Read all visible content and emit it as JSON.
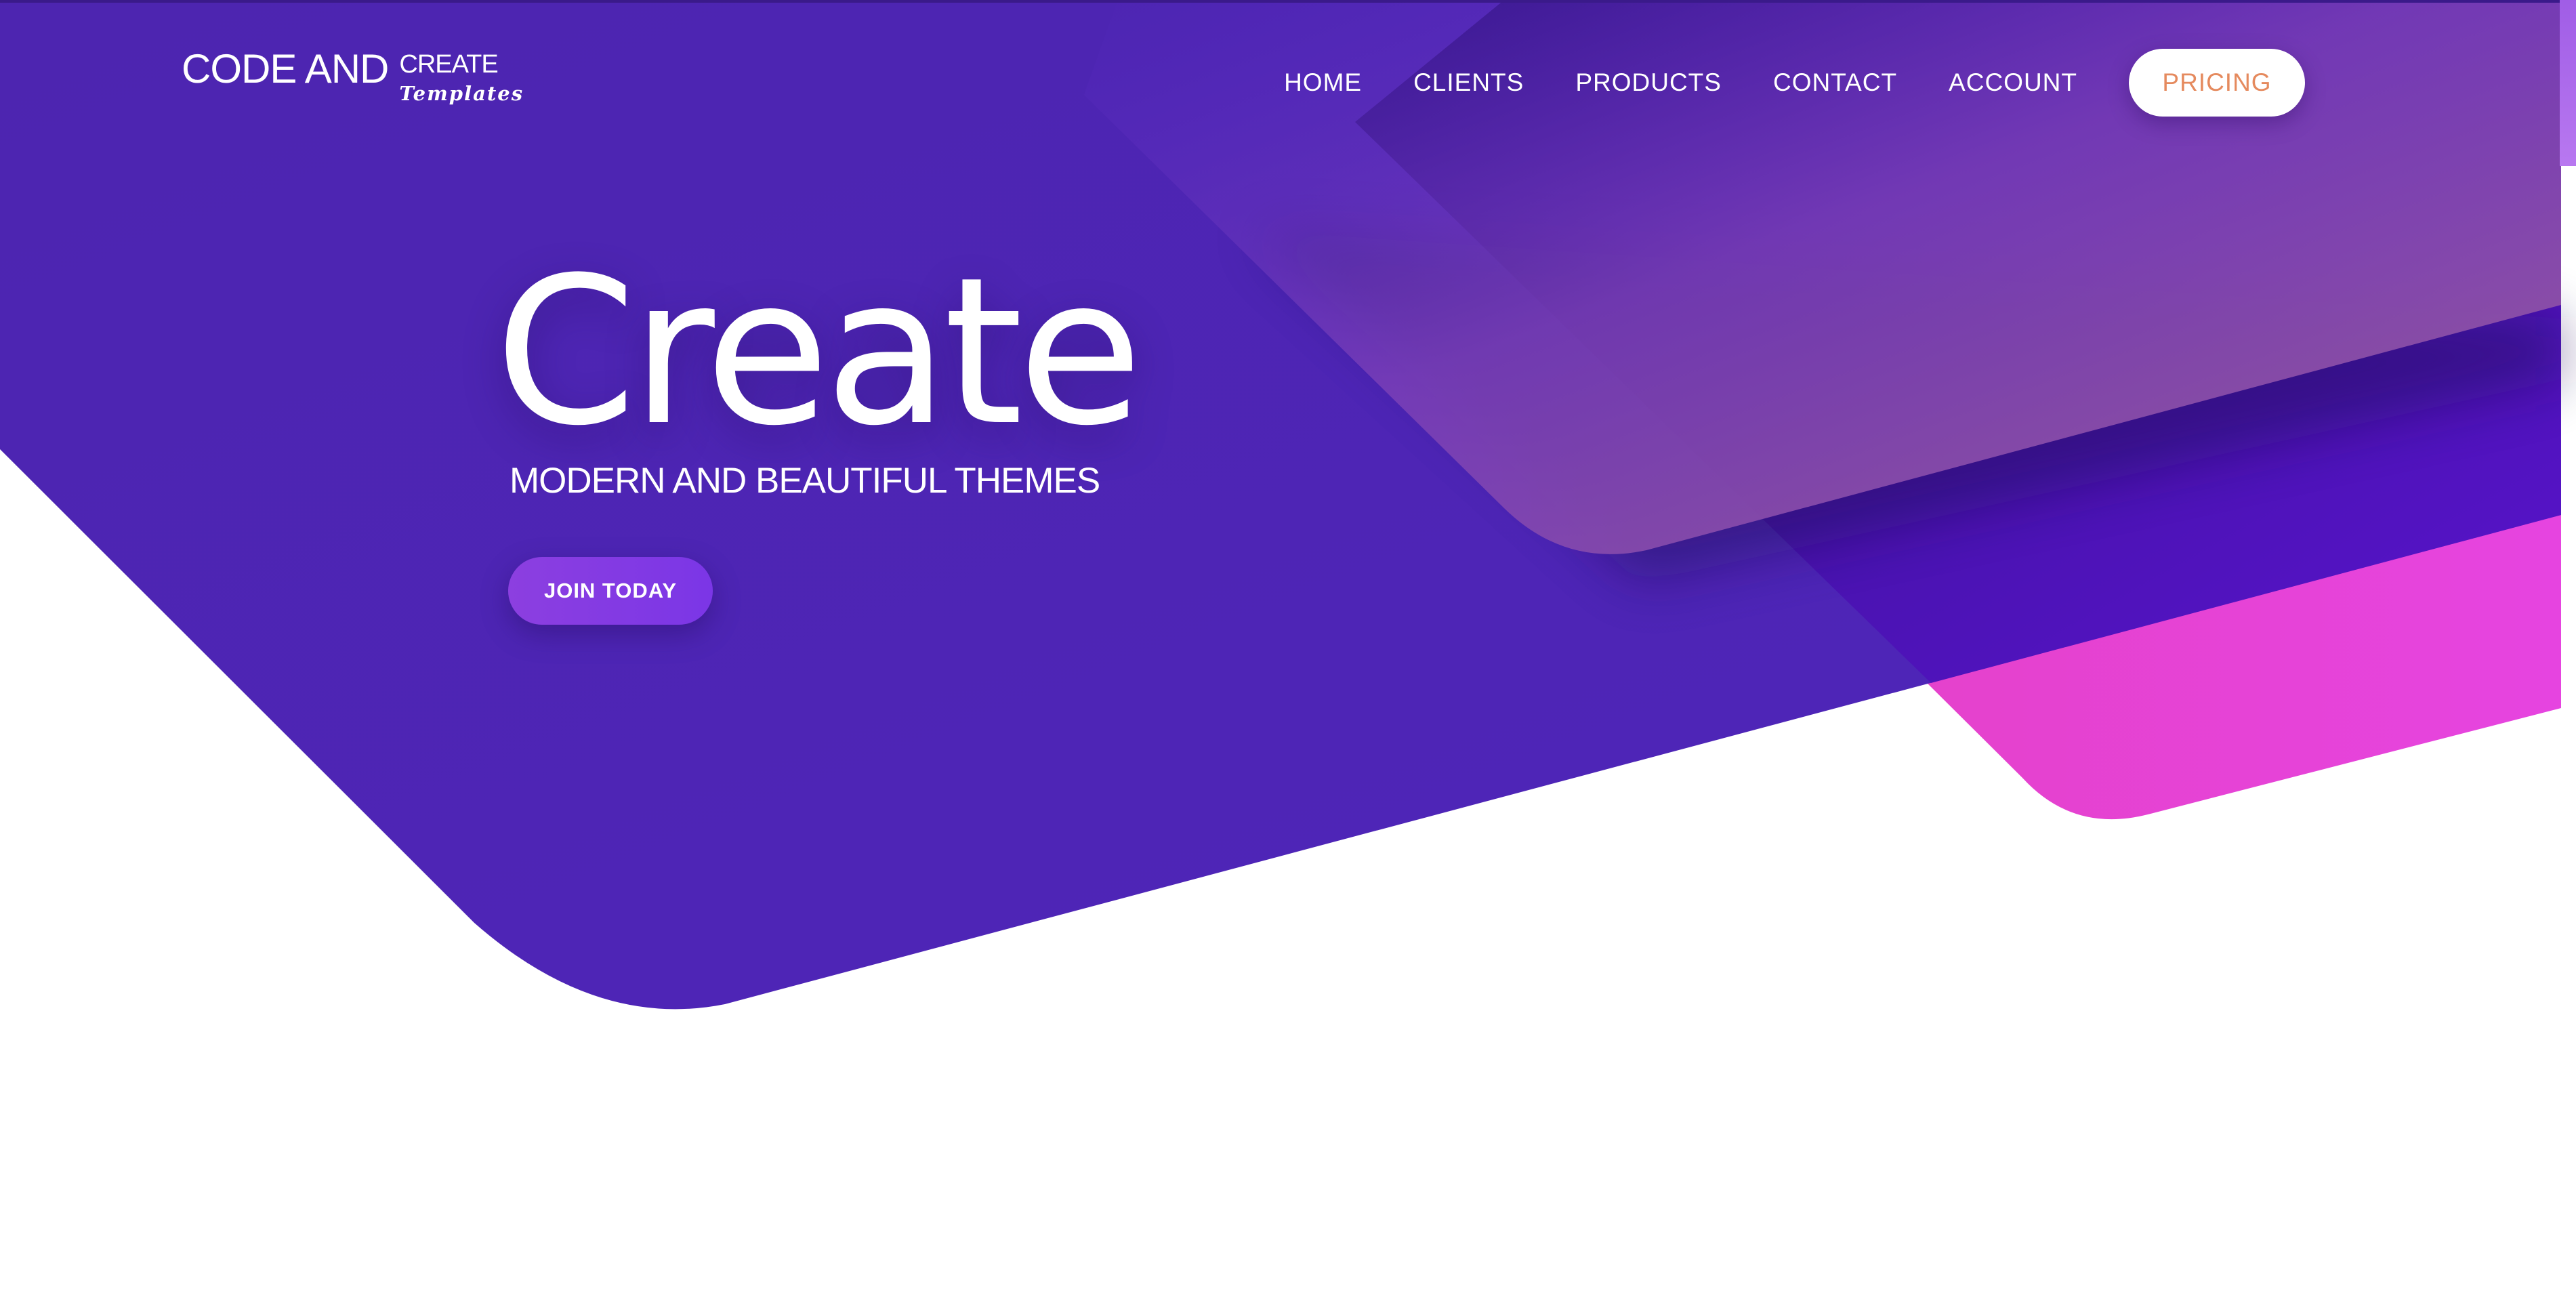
{
  "brand": {
    "main": "CODE AND",
    "create": "CREATE",
    "templates": "Templates"
  },
  "nav": {
    "items": [
      "HOME",
      "CLIENTS",
      "PRODUCTS",
      "CONTACT",
      "ACCOUNT"
    ],
    "pricing": "PRICING"
  },
  "hero": {
    "title": "Create",
    "subtitle": "MODERN AND BEAUTIFUL THEMES",
    "cta": "JOIN TODAY"
  },
  "colors": {
    "primary": "#4f25b5",
    "accent_pink": "#e23fd3",
    "pricing_text": "#e58a5e",
    "button": "#8c3fe0"
  }
}
